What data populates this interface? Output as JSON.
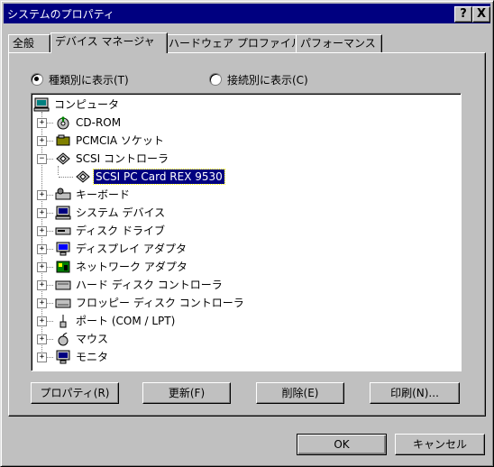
{
  "window": {
    "title": "システムのプロパティ"
  },
  "titlebar_buttons": {
    "help": "?",
    "close": "X"
  },
  "tabs": [
    {
      "label": "全般"
    },
    {
      "label": "デバイス マネージャ"
    },
    {
      "label": "ハードウェア プロファイル"
    },
    {
      "label": "パフォーマンス"
    }
  ],
  "view_options": {
    "by_type": "種類別に表示(T)",
    "by_connection": "接続別に表示(C)",
    "selected": "by_type"
  },
  "tree": {
    "root": "コンピュータ",
    "items": [
      {
        "label": "CD-ROM",
        "icon": "cdrom-icon",
        "expanded": false
      },
      {
        "label": "PCMCIA ソケット",
        "icon": "pcmcia-icon",
        "expanded": false
      },
      {
        "label": "SCSI コントローラ",
        "icon": "scsi-icon",
        "expanded": true
      },
      {
        "label": "SCSI PC Card REX 9530",
        "icon": "scsi-icon",
        "child": true,
        "selected": true
      },
      {
        "label": "キーボード",
        "icon": "keyboard-icon",
        "expanded": false
      },
      {
        "label": "システム デバイス",
        "icon": "computer-icon",
        "expanded": false
      },
      {
        "label": "ディスク ドライブ",
        "icon": "disk-drive-icon",
        "expanded": false
      },
      {
        "label": "ディスプレイ アダプタ",
        "icon": "display-icon",
        "expanded": false
      },
      {
        "label": "ネットワーク アダプタ",
        "icon": "network-icon",
        "expanded": false
      },
      {
        "label": "ハード ディスク コントローラ",
        "icon": "hdd-controller-icon",
        "expanded": false
      },
      {
        "label": "フロッピー ディスク コントローラ",
        "icon": "floppy-controller-icon",
        "expanded": false
      },
      {
        "label": "ポート (COM / LPT)",
        "icon": "port-icon",
        "expanded": false
      },
      {
        "label": "マウス",
        "icon": "mouse-icon",
        "expanded": false
      },
      {
        "label": "モニタ",
        "icon": "monitor-icon",
        "expanded": false
      }
    ]
  },
  "actions": {
    "properties": "プロパティ(R)",
    "refresh": "更新(F)",
    "remove": "削除(E)",
    "print": "印刷(N)..."
  },
  "dialog": {
    "ok": "OK",
    "cancel": "キャンセル"
  },
  "colors": {
    "face": "#c0c0c0",
    "title_bar": "#000080",
    "selection": "#000080"
  }
}
